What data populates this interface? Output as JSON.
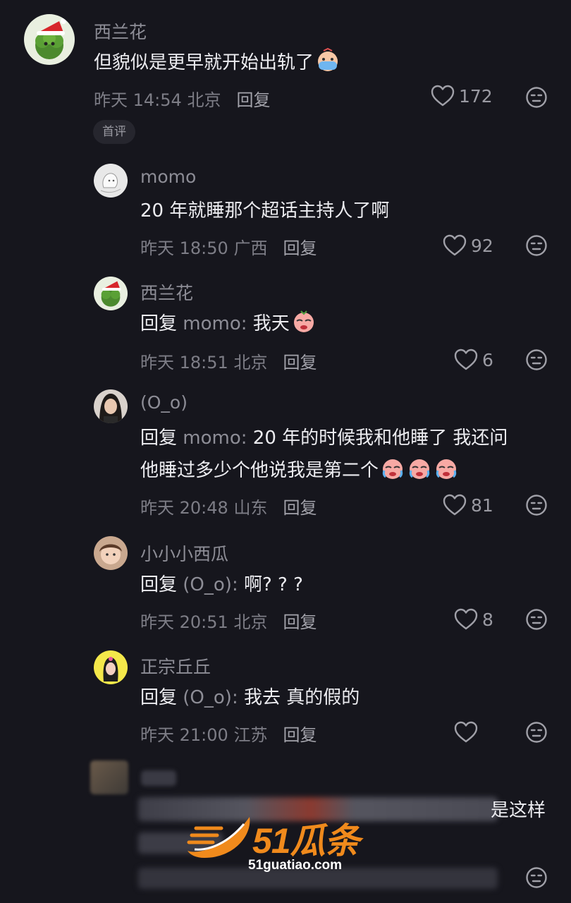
{
  "comments": [
    {
      "username": "西兰花",
      "text": "但貌似是更早就开始出轨了",
      "emoji": "crying-face-emoji",
      "date": "昨天",
      "time": "14:54",
      "location": "北京",
      "reply_label": "回复",
      "likes": "172",
      "badge": "首评"
    }
  ],
  "replies": [
    {
      "username": "momo",
      "reply_prefix": "",
      "reply_to": "",
      "text": "20 年就睡那个超话主持人了啊",
      "date": "昨天",
      "time": "18:50",
      "location": "广西",
      "reply_label": "回复",
      "likes": "92"
    },
    {
      "username": "西兰花",
      "reply_prefix": "回复",
      "reply_to": "momo:",
      "text": " 我天",
      "date": "昨天",
      "time": "18:51",
      "location": "北京",
      "reply_label": "回复",
      "likes": "6"
    },
    {
      "username": "(O_o)",
      "reply_prefix": "回复",
      "reply_to": "momo:",
      "text": " 20 年的时候我和他睡了 我还问",
      "text2": "他睡过多少个他说我是第二个",
      "date": "昨天",
      "time": "20:48",
      "location": "山东",
      "reply_label": "回复",
      "likes": "81"
    },
    {
      "username": "小小小西瓜",
      "reply_prefix": "回复",
      "reply_to": "(O_o):",
      "text": " 啊? ? ?",
      "date": "昨天",
      "time": "20:51",
      "location": "北京",
      "reply_label": "回复",
      "likes": "8"
    },
    {
      "username": "正宗丘丘",
      "reply_prefix": "回复",
      "reply_to": "(O_o):",
      "text": " 我去 真的假的",
      "date": "昨天",
      "time": "21:00",
      "location": "江苏",
      "reply_label": "回复",
      "likes": ""
    }
  ],
  "blurred_comment": {
    "visible_text": "是这样"
  },
  "watermark": {
    "brand": "51瓜条",
    "url": "51guatiao.com"
  },
  "colors": {
    "background": "#16161d",
    "text": "#ececf0",
    "muted": "#8d8d96",
    "watermark_orange": "#f08a1c"
  }
}
